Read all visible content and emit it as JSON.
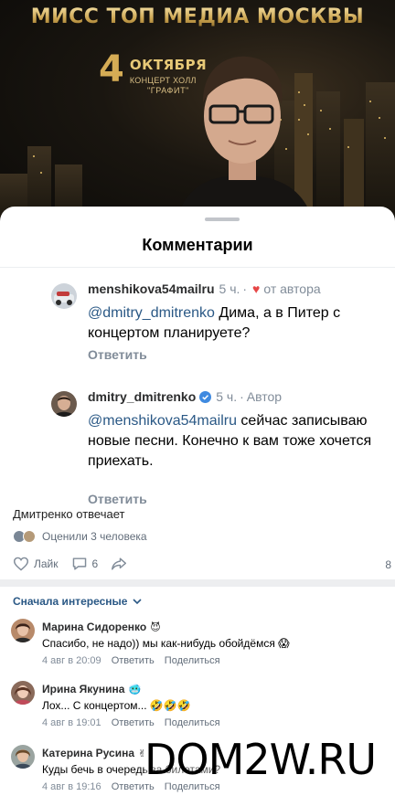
{
  "poster": {
    "title": "МИСС ТОП МЕДИА МОСКВЫ",
    "day": "4",
    "month": "ОКТЯБРЯ",
    "venue_line": "КОНЦЕРТ ХОЛЛ",
    "venue_name": "\"ГРАФИТ\""
  },
  "sheet": {
    "title": "Комментарии",
    "threads": [
      {
        "author": "menshikova54mailru",
        "time": "5 ч.",
        "heart": "♥",
        "author_mark": "от автора",
        "mention": "@dmitry_dmitrenko",
        "text": " Дима, а в Питер с концертом планируете?",
        "reply": "Ответить"
      },
      {
        "author": "dmitry_dmitrenko",
        "time": "5 ч.",
        "author_mark": "Автор",
        "mention": "@menshikova54mailru",
        "text": " сейчас записываю новые песни. Конечно к вам тоже хочется приехать.",
        "reply": "Ответить"
      }
    ]
  },
  "post": {
    "caption": "Дмитренко отвечает",
    "reactions_text": "Оценили 3 человека",
    "like_label": "Лайк",
    "comments_count": "6",
    "views_count": "8"
  },
  "comments_section": {
    "sort_label": "Сначала интересные",
    "items": [
      {
        "name": "Марина Сидоренко",
        "badge": "😈",
        "text": "Спасибо, не надо)) мы как-нибудь обойдёмся 😱",
        "date": "4 авг в 20:09",
        "reply": "Ответить",
        "share": "Поделиться"
      },
      {
        "name": "Ирина Якунина",
        "badge": "🥶",
        "text": "Лох... С концертом... 🤣🤣🤣",
        "date": "4 авг в 19:01",
        "reply": "Ответить",
        "share": "Поделиться"
      },
      {
        "name": "Катерина Русина",
        "badge": "✌",
        "text": "Куды бечь в очередь за билетами?",
        "date": "4 авг в 19:16",
        "reply": "Ответить",
        "share": "Поделиться"
      }
    ]
  },
  "watermark": "DOM2W.RU",
  "colors": {
    "link": "#2a5885",
    "meta": "#818c99",
    "heart": "#e64646",
    "verified": "#3f8ae0",
    "poster_gold": "#d5ac55"
  }
}
